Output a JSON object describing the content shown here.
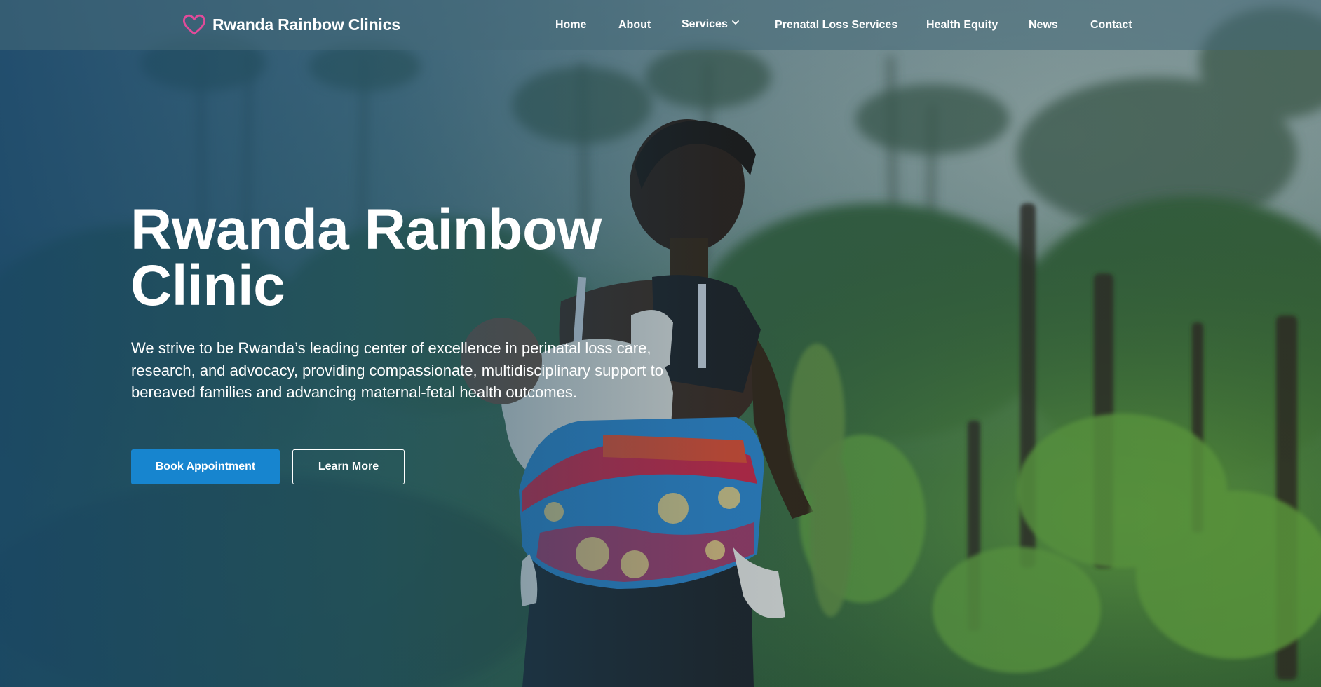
{
  "header": {
    "brand_name": "Rwanda Rainbow Clinics",
    "brand_icon": "heart-icon",
    "brand_icon_color": "#e14b9a",
    "nav": [
      {
        "label": "Home"
      },
      {
        "label": "About"
      },
      {
        "label": "Services",
        "has_dropdown": true,
        "dropdown_icon": "chevron-down-icon"
      },
      {
        "label": "Prenatal Loss Services"
      },
      {
        "label": "Health Equity"
      },
      {
        "label": "News"
      },
      {
        "label": "Contact"
      }
    ]
  },
  "hero": {
    "title": "Rwanda Rainbow Clinic",
    "subtitle": "We strive to be Rwanda’s leading center of excellence in perinatal loss care, research, and advocacy, providing compassionate, multidisciplinary support to bereaved families and advancing maternal-fetal health outcomes.",
    "primary_button": "Book Appointment",
    "secondary_button": "Learn More"
  },
  "colors": {
    "primary_button": "#1785cf",
    "overlay": "#184669",
    "text": "#ffffff"
  }
}
